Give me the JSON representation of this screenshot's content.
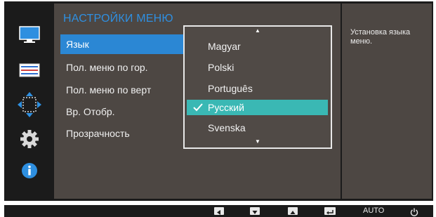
{
  "sidebar": {
    "icons": [
      "monitor-icon",
      "picture-settings-icon",
      "position-arrows-icon",
      "gear-icon",
      "info-icon"
    ]
  },
  "menu": {
    "title": "НАСТРОЙКИ МЕНЮ",
    "items": [
      {
        "label": "Язык",
        "selected": true
      },
      {
        "label": "Пол. меню по гор.",
        "selected": false
      },
      {
        "label": "Пол. меню по верт",
        "selected": false
      },
      {
        "label": "Вр. Отобр.",
        "selected": false
      },
      {
        "label": "Прозрачность",
        "selected": false
      }
    ]
  },
  "dropdown": {
    "up_arrow": "▲",
    "down_arrow": "▼",
    "options": [
      {
        "label": "Magyar",
        "checked": false
      },
      {
        "label": "Polski",
        "checked": false
      },
      {
        "label": "Português",
        "checked": false
      },
      {
        "label": "Русский",
        "checked": true
      },
      {
        "label": "Svenska",
        "checked": false
      }
    ]
  },
  "help": {
    "text": "Установка языка меню."
  },
  "bottom_bar": {
    "buttons": [
      "left-arrow-key",
      "down-arrow-key",
      "up-arrow-key",
      "enter-key",
      "AUTO",
      "power-icon"
    ],
    "auto_label": "AUTO"
  },
  "colors": {
    "panel": "#4d4743",
    "frame": "#1b1b1b",
    "title_blue": "#2f8fe0",
    "selected_blue": "#2b87d4",
    "checked_teal": "#3ab8b4"
  }
}
